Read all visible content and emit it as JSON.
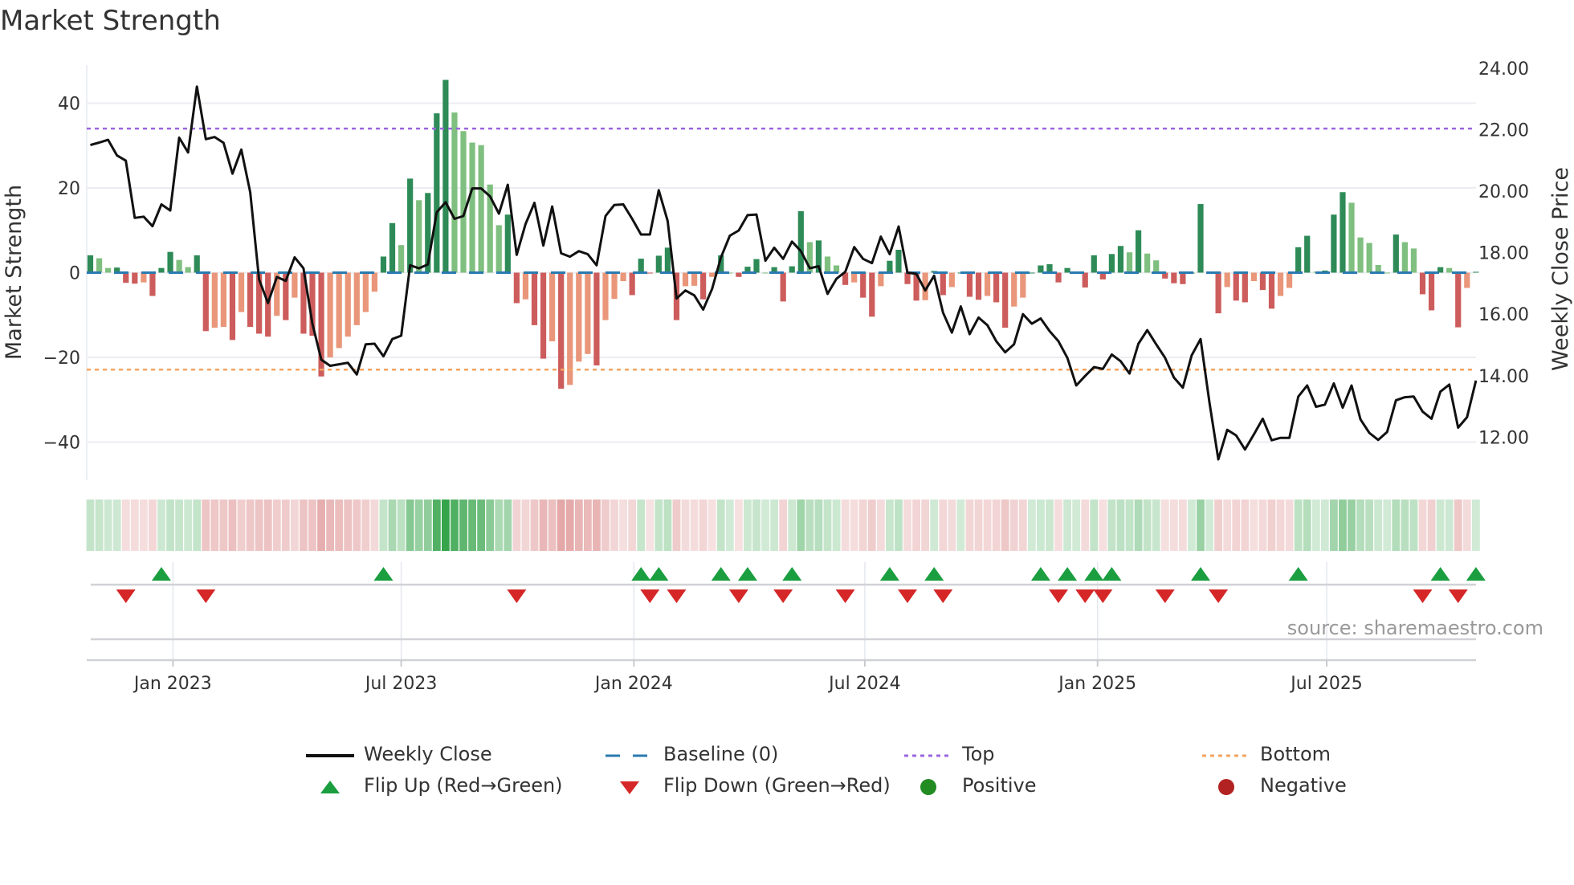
{
  "title": "Market Strength",
  "source": "source: sharemaestro.com",
  "colors": {
    "strong_green": "#2e8b57",
    "weak_green": "#7fbf7f",
    "strong_red": "#cd5c5c",
    "weak_red": "#e9967a",
    "line": "#111111",
    "baseline": "#2a7ab0",
    "top": "#9b66dd",
    "bottom": "#f4a460",
    "flip_up": "#1a9e3f",
    "flip_down": "#d62728",
    "positive": "#228b22",
    "negative": "#b22222"
  },
  "legend": {
    "weekly_close": "Weekly Close",
    "baseline": "Baseline (0)",
    "top": "Top",
    "bottom": "Bottom",
    "flip_up": "Flip Up (Red→Green)",
    "flip_down": "Flip Down (Green→Red)",
    "positive": "Positive",
    "negative": "Negative"
  },
  "chart_data": {
    "type": "bar+line",
    "title": "Market Strength",
    "ylabel": "Market Strength",
    "y2label": "Weekly Close Price",
    "ylim": [
      -49,
      49
    ],
    "y2lim": [
      10.6,
      24.1
    ],
    "yticks": [
      {
        "v": 40,
        "label": "40"
      },
      {
        "v": 20,
        "label": "20"
      },
      {
        "v": 0,
        "label": "0"
      },
      {
        "v": -20,
        "label": "−20"
      },
      {
        "v": -40,
        "label": "−40"
      }
    ],
    "y2ticks": [
      {
        "v": 24,
        "label": "24.00"
      },
      {
        "v": 22,
        "label": "22.00"
      },
      {
        "v": 20,
        "label": "20.00"
      },
      {
        "v": 18,
        "label": "18.00"
      },
      {
        "v": 16,
        "label": "16.00"
      },
      {
        "v": 14,
        "label": "14.00"
      },
      {
        "v": 12,
        "label": "12.00"
      }
    ],
    "xticks": [
      {
        "week": 9.3,
        "label": "Jan 2023"
      },
      {
        "week": 35.0,
        "label": "Jul 2023"
      },
      {
        "week": 61.2,
        "label": "Jan 2024"
      },
      {
        "week": 87.2,
        "label": "Jul 2024"
      },
      {
        "week": 113.4,
        "label": "Jan 2025"
      },
      {
        "week": 139.2,
        "label": "Jul 2025"
      }
    ],
    "top_level": 34,
    "bottom_level": -22.9,
    "baseline": 0,
    "strength": [
      4.1,
      3.4,
      1.1,
      1.2,
      -2.4,
      -2.6,
      -2.3,
      -5.5,
      1.1,
      4.9,
      3.0,
      1.3,
      4.1,
      -13.8,
      -13,
      -12.8,
      -15.9,
      -9.3,
      -12.8,
      -14.4,
      -15.1,
      -10.2,
      -11.2,
      -5.9,
      -14.4,
      -14.9,
      -24.5,
      -20,
      -17.8,
      -15.1,
      -12.4,
      -9.3,
      -4.5,
      3.8,
      11.7,
      6.5,
      22.2,
      17.1,
      18.8,
      37.6,
      45.5,
      37.8,
      33.4,
      30.7,
      30.1,
      20.8,
      11.2,
      13.7,
      -7.2,
      -6.3,
      -12.4,
      -20.3,
      -16.2,
      -27.4,
      -26.5,
      -21,
      -19.2,
      -21.9,
      -11.2,
      -6.2,
      -2,
      -5.3,
      3.3,
      -0.2,
      4.0,
      5.9,
      -11.2,
      -3.2,
      -3.1,
      -6.3,
      -1,
      4.1,
      0,
      -1,
      1.4,
      3.2,
      0,
      1.3,
      -6.8,
      1.5,
      14.5,
      7.2,
      7.6,
      3.8,
      1.7,
      -2.9,
      -2.3,
      -5.9,
      -10.4,
      -3.2,
      2.8,
      5.4,
      -2.7,
      -6.6,
      -6.5,
      0.4,
      -5.3,
      -3.4,
      0,
      -5.7,
      -6.4,
      -5.5,
      -7,
      -13,
      -8,
      -5.9,
      0,
      1.7,
      2,
      -2.3,
      1.1,
      0,
      -3.5,
      4.1,
      -1.6,
      4.4,
      6.3,
      4.8,
      10,
      4.5,
      2.9,
      -1.4,
      -2.5,
      -2.7,
      0,
      16.2,
      0,
      -9.6,
      -3.4,
      -6.6,
      -7,
      -2,
      -4.1,
      -8.5,
      -5.5,
      -3.6,
      6.0,
      8.7,
      0.2,
      0.5,
      13.7,
      19,
      16.5,
      8.3,
      7,
      1.8,
      0,
      9,
      7.2,
      5.7,
      -5.1,
      -8.9,
      1.3,
      1.1,
      -12.9,
      -3.6,
      0.2
    ],
    "weekly_close": [
      21.5,
      21.58,
      21.67,
      21.16,
      20.99,
      19.13,
      19.17,
      18.86,
      19.57,
      19.37,
      21.74,
      21.26,
      23.4,
      21.69,
      21.76,
      21.57,
      20.57,
      21.35,
      19.96,
      17.13,
      16.36,
      17.21,
      17.08,
      17.85,
      17.49,
      15.69,
      14.52,
      14.32,
      14.37,
      14.42,
      14.04,
      15.02,
      15.04,
      14.63,
      15.19,
      15.3,
      17.59,
      17.49,
      17.62,
      19.31,
      19.64,
      19.1,
      19.19,
      20.09,
      20.09,
      19.83,
      19.27,
      20.21,
      17.93,
      18.93,
      19.62,
      18.23,
      19.5,
      17.98,
      17.87,
      18.05,
      17.95,
      17.59,
      19.19,
      19.55,
      19.57,
      19.1,
      18.59,
      18.59,
      20.03,
      19.03,
      16.51,
      16.77,
      16.61,
      16.15,
      16.82,
      17.85,
      18.55,
      18.72,
      19.22,
      19.24,
      17.74,
      18.16,
      17.8,
      18.36,
      18.05,
      17.49,
      17.56,
      16.66,
      17.15,
      17.38,
      18.18,
      17.8,
      17.66,
      18.52,
      17.95,
      18.85,
      17.35,
      17.31,
      16.77,
      17.25,
      16.05,
      15.4,
      16.25,
      15.35,
      15.89,
      15.64,
      15.12,
      14.76,
      15.02,
      16.0,
      15.69,
      15.86,
      15.45,
      15.12,
      14.58,
      13.68,
      13.99,
      14.28,
      14.22,
      14.69,
      14.47,
      14.07,
      15.04,
      15.48,
      15.02,
      14.58,
      13.94,
      13.61,
      14.66,
      15.19,
      13.12,
      11.28,
      12.24,
      12.06,
      11.6,
      12.09,
      12.6,
      11.9,
      11.98,
      11.98,
      13.32,
      13.68,
      12.99,
      13.06,
      13.75,
      12.96,
      13.68,
      12.58,
      12.14,
      11.91,
      12.17,
      13.2,
      13.3,
      13.32,
      12.83,
      12.6,
      13.48,
      13.71,
      12.31,
      12.65,
      13.84
    ]
  }
}
